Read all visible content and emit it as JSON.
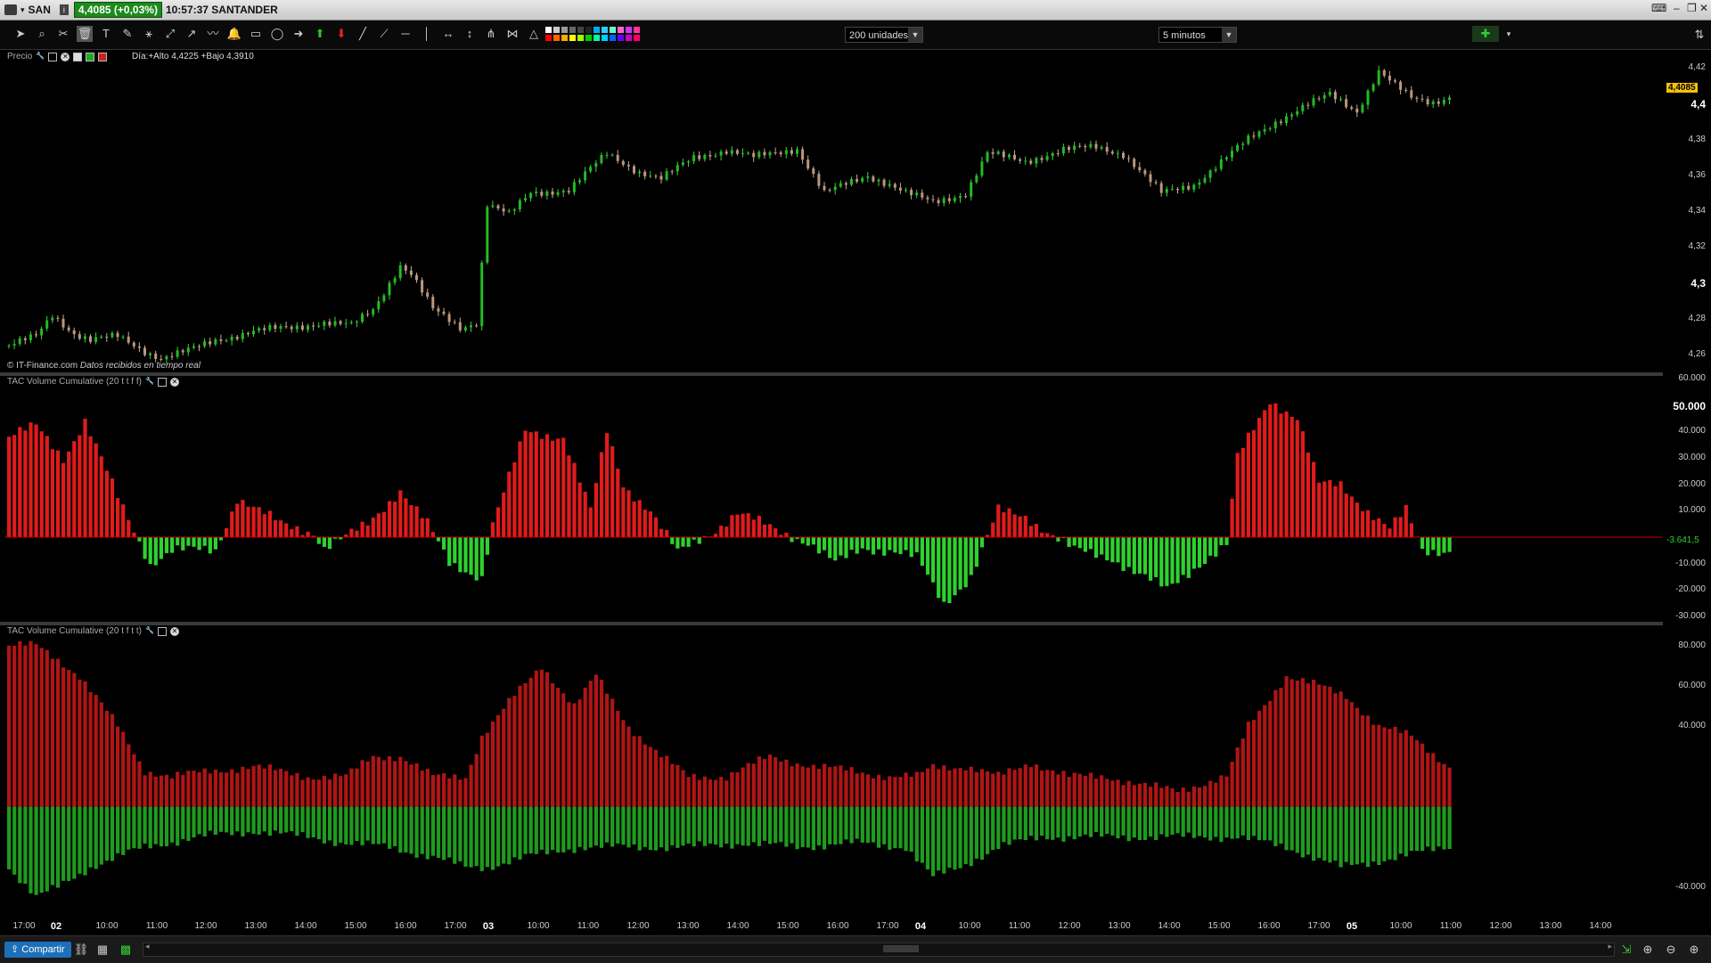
{
  "titlebar": {
    "symbol": "SAN",
    "price_badge": "4,4085 (+0,03%)",
    "time_name": "10:57:37 SANTANDER"
  },
  "toolbar": {
    "units_value": "200 unidades",
    "timeframe_value": "5 minutos",
    "tools": [
      "cursor-icon",
      "zoom-icon",
      "crosshair-icon",
      "trash-icon",
      "text-icon",
      "ruler-icon",
      "fibonacci-icon",
      "channel-icon",
      "trend-icon",
      "zigzag-icon",
      "alarm-icon",
      "rectangle-icon",
      "ellipse-icon",
      "arrow-right-icon",
      "arrow-up-icon",
      "arrow-down-icon",
      "line-icon",
      "ray-icon",
      "horizontal-line-icon",
      "vertical-line-icon",
      "measure-icon",
      "vertical-measure-icon",
      "andrews-icon",
      "gann-icon",
      "triangle-icon"
    ],
    "swatch_colors": [
      "#ffffff",
      "#cccccc",
      "#999999",
      "#666666",
      "#444444",
      "#222222",
      "#00aaff",
      "#33ccff",
      "#66ffcc",
      "#ff66cc",
      "#cc33ff",
      "#ff3399",
      "#ff0000",
      "#ff6600",
      "#ffaa00",
      "#ffff00",
      "#99ff00",
      "#00cc00",
      "#00ff99",
      "#00ccff",
      "#0066ff",
      "#6600ff",
      "#cc00cc",
      "#ff0066"
    ]
  },
  "price_pane": {
    "label": "Precio",
    "day_text": "Día:+Alto 4,4225 +Bajo 4,3910",
    "copyright": "© IT-Finance.com",
    "realtime": "Datos recibidos en tiempo real",
    "last_price": "4,4085",
    "y_ticks": [
      {
        "label": "4,42",
        "v": 4.42,
        "bold": false
      },
      {
        "label": "4,4",
        "v": 4.4,
        "bold": true
      },
      {
        "label": "4,38",
        "v": 4.38,
        "bold": false
      },
      {
        "label": "4,36",
        "v": 4.36,
        "bold": false
      },
      {
        "label": "4,34",
        "v": 4.34,
        "bold": false
      },
      {
        "label": "4,32",
        "v": 4.32,
        "bold": false
      },
      {
        "label": "4,3",
        "v": 4.3,
        "bold": true
      },
      {
        "label": "4,28",
        "v": 4.28,
        "bold": false
      },
      {
        "label": "4,26",
        "v": 4.26,
        "bold": false
      }
    ]
  },
  "vol1_pane": {
    "label": "TAC Volume Cumulative (20 t t f f)",
    "last_value": "-3.641,5",
    "y_ticks": [
      {
        "label": "60.000",
        "v": 60000,
        "bold": false
      },
      {
        "label": "50.000",
        "v": 50000,
        "bold": true
      },
      {
        "label": "40.000",
        "v": 40000,
        "bold": false
      },
      {
        "label": "30.000",
        "v": 30000,
        "bold": false
      },
      {
        "label": "20.000",
        "v": 20000,
        "bold": false
      },
      {
        "label": "10.000",
        "v": 10000,
        "bold": false
      },
      {
        "label": "-10.000",
        "v": -10000,
        "bold": false
      },
      {
        "label": "-20.000",
        "v": -20000,
        "bold": false
      },
      {
        "label": "-30.000",
        "v": -30000,
        "bold": false
      }
    ]
  },
  "vol2_pane": {
    "label": "TAC Volume Cumulative (20 t f t t)",
    "y_ticks": [
      {
        "label": "80.000",
        "v": 80000,
        "bold": false
      },
      {
        "label": "60.000",
        "v": 60000,
        "bold": false
      },
      {
        "label": "40.000",
        "v": 40000,
        "bold": false
      },
      {
        "label": "-40.000",
        "v": -40000,
        "bold": false
      }
    ]
  },
  "x_axis": [
    {
      "label": "17:00",
      "bold": false
    },
    {
      "label": "02",
      "bold": true
    },
    {
      "label": "10:00",
      "bold": false
    },
    {
      "label": "11:00",
      "bold": false
    },
    {
      "label": "12:00",
      "bold": false
    },
    {
      "label": "13:00",
      "bold": false
    },
    {
      "label": "14:00",
      "bold": false
    },
    {
      "label": "15:00",
      "bold": false
    },
    {
      "label": "16:00",
      "bold": false
    },
    {
      "label": "17:00",
      "bold": false
    },
    {
      "label": "03",
      "bold": true
    },
    {
      "label": "10:00",
      "bold": false
    },
    {
      "label": "11:00",
      "bold": false
    },
    {
      "label": "12:00",
      "bold": false
    },
    {
      "label": "13:00",
      "bold": false
    },
    {
      "label": "14:00",
      "bold": false
    },
    {
      "label": "15:00",
      "bold": false
    },
    {
      "label": "16:00",
      "bold": false
    },
    {
      "label": "17:00",
      "bold": false
    },
    {
      "label": "04",
      "bold": true
    },
    {
      "label": "10:00",
      "bold": false
    },
    {
      "label": "11:00",
      "bold": false
    },
    {
      "label": "12:00",
      "bold": false
    },
    {
      "label": "13:00",
      "bold": false
    },
    {
      "label": "14:00",
      "bold": false
    },
    {
      "label": "15:00",
      "bold": false
    },
    {
      "label": "16:00",
      "bold": false
    },
    {
      "label": "17:00",
      "bold": false
    },
    {
      "label": "05",
      "bold": true
    },
    {
      "label": "10:00",
      "bold": false
    },
    {
      "label": "11:00",
      "bold": false
    },
    {
      "label": "12:00",
      "bold": false
    },
    {
      "label": "13:00",
      "bold": false
    },
    {
      "label": "14:00",
      "bold": false
    }
  ],
  "statusbar": {
    "share_label": "Compartir"
  },
  "chart_data": [
    {
      "type": "line",
      "name": "Precio",
      "ylim": [
        4.25,
        4.43
      ],
      "anchors": [
        [
          0,
          4.265
        ],
        [
          5,
          4.27
        ],
        [
          8,
          4.282
        ],
        [
          12,
          4.272
        ],
        [
          15,
          4.268
        ],
        [
          20,
          4.27
        ],
        [
          25,
          4.262
        ],
        [
          28,
          4.258
        ],
        [
          33,
          4.262
        ],
        [
          38,
          4.268
        ],
        [
          45,
          4.273
        ],
        [
          52,
          4.275
        ],
        [
          58,
          4.278
        ],
        [
          63,
          4.276
        ],
        [
          67,
          4.285
        ],
        [
          72,
          4.31
        ],
        [
          74,
          4.305
        ],
        [
          78,
          4.285
        ],
        [
          83,
          4.275
        ],
        [
          86,
          4.278
        ],
        [
          88,
          4.344
        ],
        [
          92,
          4.338
        ],
        [
          96,
          4.35
        ],
        [
          103,
          4.352
        ],
        [
          110,
          4.372
        ],
        [
          116,
          4.362
        ],
        [
          120,
          4.358
        ],
        [
          126,
          4.37
        ],
        [
          132,
          4.374
        ],
        [
          137,
          4.37
        ],
        [
          145,
          4.375
        ],
        [
          150,
          4.35
        ],
        [
          158,
          4.36
        ],
        [
          162,
          4.355
        ],
        [
          165,
          4.35
        ],
        [
          170,
          4.345
        ],
        [
          176,
          4.35
        ],
        [
          180,
          4.372
        ],
        [
          187,
          4.368
        ],
        [
          194,
          4.374
        ],
        [
          200,
          4.376
        ],
        [
          205,
          4.372
        ],
        [
          212,
          4.35
        ],
        [
          218,
          4.355
        ],
        [
          222,
          4.365
        ],
        [
          228,
          4.38
        ],
        [
          233,
          4.39
        ],
        [
          238,
          4.398
        ],
        [
          243,
          4.405
        ],
        [
          248,
          4.396
        ],
        [
          252,
          4.418
        ],
        [
          255,
          4.41
        ],
        [
          258,
          4.403
        ],
        [
          262,
          4.401
        ],
        [
          265,
          4.404
        ]
      ]
    },
    {
      "type": "bar",
      "name": "TAC Volume Cumulative (20 t t f f)",
      "ylim": [
        -32000,
        61000
      ],
      "anchors": [
        [
          0,
          38000
        ],
        [
          5,
          42000
        ],
        [
          10,
          30000
        ],
        [
          14,
          44000
        ],
        [
          20,
          15000
        ],
        [
          26,
          -10000
        ],
        [
          30,
          -5000
        ],
        [
          38,
          -5000
        ],
        [
          42,
          15000
        ],
        [
          50,
          5000
        ],
        [
          56,
          2000
        ],
        [
          58,
          -4000
        ],
        [
          62,
          0
        ],
        [
          66,
          5000
        ],
        [
          72,
          18000
        ],
        [
          77,
          5000
        ],
        [
          81,
          -10000
        ],
        [
          87,
          -15000
        ],
        [
          89,
          5000
        ],
        [
          95,
          40000
        ],
        [
          102,
          38000
        ],
        [
          107,
          10000
        ],
        [
          110,
          40000
        ],
        [
          113,
          20000
        ],
        [
          118,
          10000
        ],
        [
          123,
          -6000
        ],
        [
          130,
          3000
        ],
        [
          134,
          9000
        ],
        [
          140,
          4000
        ],
        [
          147,
          -2000
        ],
        [
          152,
          -10000
        ],
        [
          157,
          -4000
        ],
        [
          162,
          -5000
        ],
        [
          167,
          -8000
        ],
        [
          172,
          -25000
        ],
        [
          177,
          -15000
        ],
        [
          182,
          10000
        ],
        [
          187,
          8000
        ],
        [
          196,
          -5000
        ],
        [
          203,
          -8000
        ],
        [
          213,
          -20000
        ],
        [
          219,
          -10000
        ],
        [
          224,
          -3000
        ],
        [
          226,
          30000
        ],
        [
          232,
          52000
        ],
        [
          237,
          45000
        ],
        [
          241,
          20000
        ],
        [
          245,
          20000
        ],
        [
          250,
          10000
        ],
        [
          254,
          3000
        ],
        [
          257,
          10000
        ],
        [
          260,
          -5000
        ],
        [
          265,
          -5000
        ]
      ]
    },
    {
      "type": "bar",
      "name": "TAC Volume Cumulative (20 t f t t)",
      "ylim": [
        -55000,
        90000
      ],
      "pos_anchors": [
        [
          0,
          80000
        ],
        [
          5,
          80000
        ],
        [
          8,
          75000
        ],
        [
          13,
          65000
        ],
        [
          20,
          40000
        ],
        [
          25,
          18000
        ],
        [
          30,
          15000
        ],
        [
          38,
          18000
        ],
        [
          45,
          20000
        ],
        [
          55,
          15000
        ],
        [
          62,
          15000
        ],
        [
          67,
          25000
        ],
        [
          72,
          25000
        ],
        [
          78,
          15000
        ],
        [
          84,
          15000
        ],
        [
          87,
          35000
        ],
        [
          93,
          55000
        ],
        [
          98,
          70000
        ],
        [
          104,
          50000
        ],
        [
          108,
          65000
        ],
        [
          114,
          40000
        ],
        [
          120,
          25000
        ],
        [
          125,
          15000
        ],
        [
          132,
          15000
        ],
        [
          140,
          25000
        ],
        [
          148,
          20000
        ],
        [
          155,
          18000
        ],
        [
          162,
          15000
        ],
        [
          167,
          15000
        ],
        [
          170,
          20000
        ],
        [
          176,
          20000
        ],
        [
          182,
          15000
        ],
        [
          188,
          22000
        ],
        [
          195,
          15000
        ],
        [
          202,
          15000
        ],
        [
          210,
          10000
        ],
        [
          215,
          8000
        ],
        [
          224,
          15000
        ],
        [
          228,
          40000
        ],
        [
          235,
          65000
        ],
        [
          241,
          60000
        ],
        [
          246,
          55000
        ],
        [
          252,
          40000
        ],
        [
          258,
          35000
        ],
        [
          265,
          20000
        ]
      ],
      "neg_anchors": [
        [
          0,
          -30000
        ],
        [
          5,
          -45000
        ],
        [
          9,
          -40000
        ],
        [
          15,
          -30000
        ],
        [
          25,
          -20000
        ],
        [
          35,
          -15000
        ],
        [
          45,
          -12000
        ],
        [
          55,
          -15000
        ],
        [
          62,
          -18000
        ],
        [
          70,
          -20000
        ],
        [
          78,
          -25000
        ],
        [
          84,
          -30000
        ],
        [
          88,
          -30000
        ],
        [
          95,
          -25000
        ],
        [
          105,
          -20000
        ],
        [
          115,
          -20000
        ],
        [
          125,
          -20000
        ],
        [
          135,
          -18000
        ],
        [
          145,
          -20000
        ],
        [
          155,
          -18000
        ],
        [
          165,
          -20000
        ],
        [
          170,
          -35000
        ],
        [
          175,
          -30000
        ],
        [
          182,
          -20000
        ],
        [
          190,
          -15000
        ],
        [
          200,
          -15000
        ],
        [
          210,
          -15000
        ],
        [
          220,
          -15000
        ],
        [
          226,
          -15000
        ],
        [
          235,
          -20000
        ],
        [
          240,
          -25000
        ],
        [
          245,
          -30000
        ],
        [
          250,
          -28000
        ],
        [
          255,
          -25000
        ],
        [
          265,
          -20000
        ]
      ]
    }
  ]
}
